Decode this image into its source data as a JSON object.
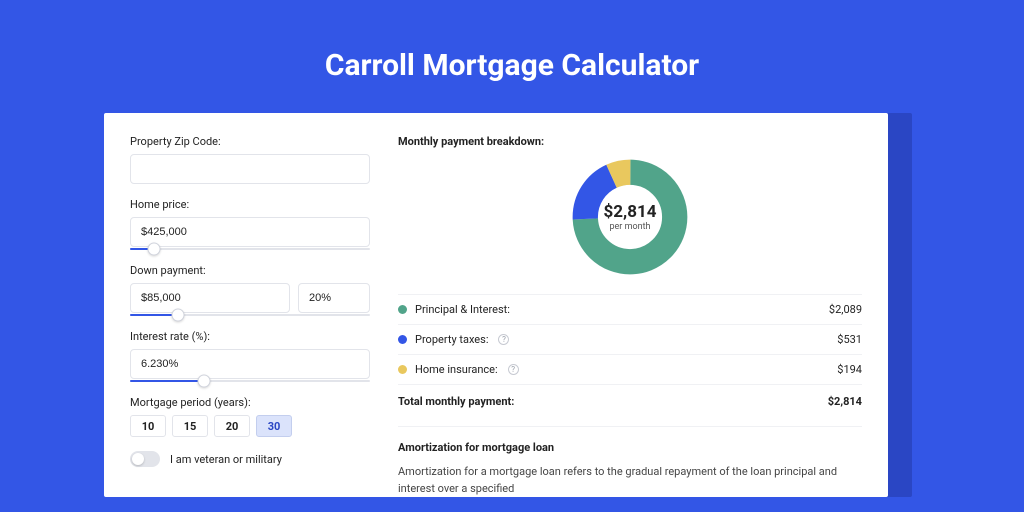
{
  "title": "Carroll Mortgage Calculator",
  "colors": {
    "principal": "#51a48a",
    "taxes": "#3356e6",
    "insurance": "#e9c85e"
  },
  "form": {
    "zip": {
      "label": "Property Zip Code:",
      "value": ""
    },
    "home_price": {
      "label": "Home price:",
      "value": "$425,000",
      "slider_pct": 10
    },
    "down_payment": {
      "label": "Down payment:",
      "value": "$85,000",
      "pct": "20%",
      "slider_pct": 20
    },
    "interest": {
      "label": "Interest rate (%):",
      "value": "6.230%",
      "slider_pct": 31
    },
    "period": {
      "label": "Mortgage period (years):",
      "options": [
        "10",
        "15",
        "20",
        "30"
      ],
      "selected": "30"
    },
    "veteran": {
      "label": "I am veteran or military",
      "on": false
    }
  },
  "breakdown": {
    "title": "Monthly payment breakdown:",
    "center_amount": "$2,814",
    "center_sub": "per month",
    "items": [
      {
        "key": "principal",
        "label": "Principal & Interest:",
        "value": "$2,089",
        "help": false
      },
      {
        "key": "taxes",
        "label": "Property taxes:",
        "value": "$531",
        "help": true
      },
      {
        "key": "insurance",
        "label": "Home insurance:",
        "value": "$194",
        "help": true
      }
    ],
    "total_label": "Total monthly payment:",
    "total_value": "$2,814"
  },
  "amortization": {
    "title": "Amortization for mortgage loan",
    "text": "Amortization for a mortgage loan refers to the gradual repayment of the loan principal and interest over a specified"
  },
  "chart_data": {
    "type": "pie",
    "title": "Monthly payment breakdown",
    "series": [
      {
        "name": "Principal & Interest",
        "value": 2089,
        "color": "#51a48a"
      },
      {
        "name": "Property taxes",
        "value": 531,
        "color": "#3356e6"
      },
      {
        "name": "Home insurance",
        "value": 194,
        "color": "#e9c85e"
      }
    ],
    "total": 2814,
    "center_label": "$2,814 per month"
  }
}
